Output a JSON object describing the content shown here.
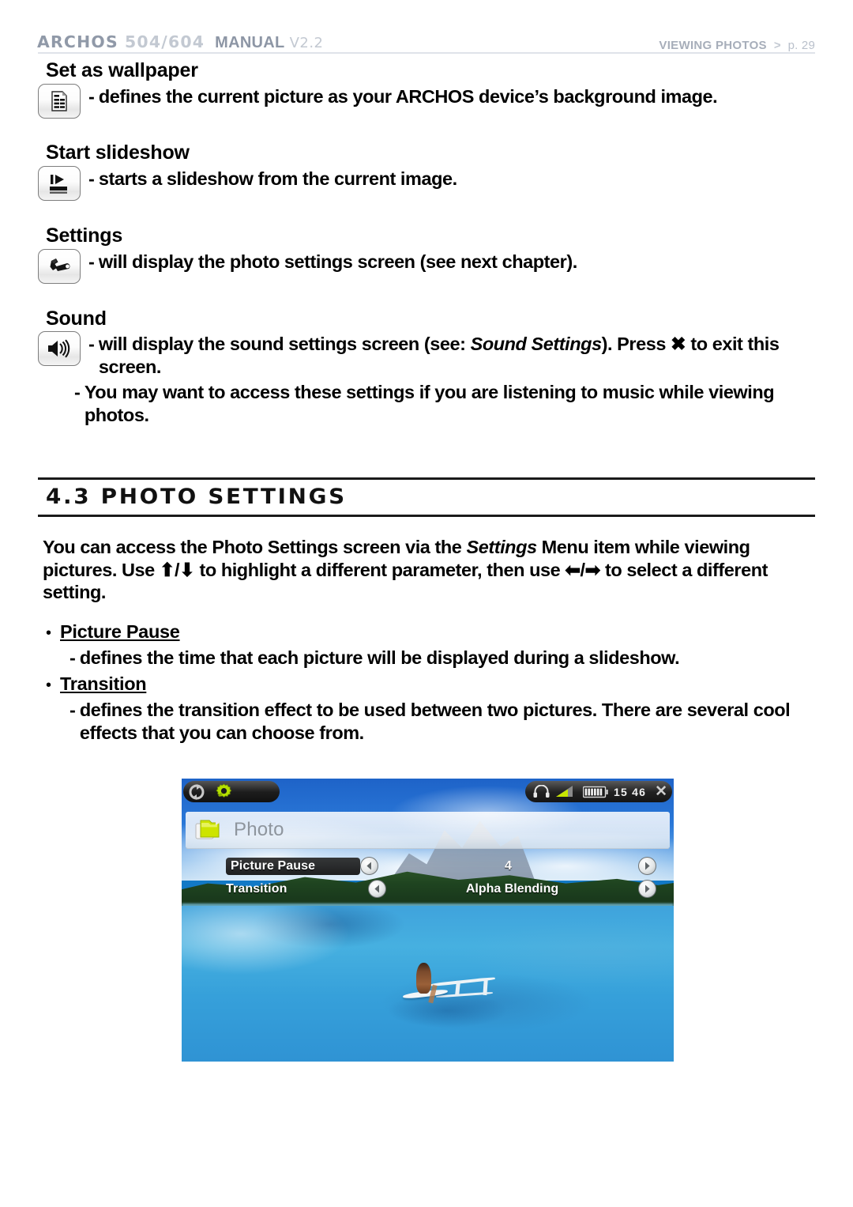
{
  "header": {
    "brand": "ARCHOS",
    "model": "504/604",
    "manual": "MANUAL",
    "version": "V2.2",
    "section": "VIEWING PHOTOS",
    "separator": ">",
    "page": "p. 29"
  },
  "entries": [
    {
      "title": "Set as wallpaper",
      "icon": "document-lines-icon",
      "desc_dash": "-",
      "desc": "defines the current picture as your ARCHOS device’s background image."
    },
    {
      "title": "Start slideshow",
      "icon": "slideshow-play-icon",
      "desc_dash": "-",
      "desc": "starts a slideshow from the current image."
    },
    {
      "title": "Settings",
      "icon": "wrench-icon",
      "desc_dash": "-",
      "desc": "will display the photo settings screen (see next chapter)."
    },
    {
      "title": "Sound",
      "icon": "speaker-icon",
      "desc_dash": "-",
      "desc_part1": "will display the sound settings screen (see: ",
      "desc_italic": "Sound Settings",
      "desc_part2": "). Press ✖ to exit this screen.",
      "sub_dash": "-",
      "sub": "You may want to access these settings if you are listening to music while viewing photos."
    }
  ],
  "section": {
    "number": "4.3",
    "title": "PHOTO SETTINGS",
    "intro_part1": "You can access the Photo Settings screen via the ",
    "intro_italic": "Settings",
    "intro_part2": " Menu item while viewing pictures. Use ⬆/⬇ to highlight a different parameter, then use ⬅/➡ to select a different setting."
  },
  "bullets": [
    {
      "marker": "•",
      "head": "Picture Pause",
      "dash": "-",
      "desc": "defines the time that each picture will be displayed during a slideshow."
    },
    {
      "marker": "•",
      "head": "Transition",
      "dash": "-",
      "desc": "defines the transition effect to be used between two pictures. There are several cool effects that you can choose from."
    }
  ],
  "device": {
    "toolbar": {
      "rotate_icon": "rotate-refresh-icon",
      "settings_icon": "gear-wrench-icon",
      "headphone_icon": "headphone-icon",
      "volume_icon": "volume-wedge-icon",
      "battery_icon": "battery-icon",
      "clock": "15 46",
      "close_icon": "close-x-icon"
    },
    "panel_title": "Photo",
    "panel_icon": "photo-folder-icon",
    "rows": [
      {
        "name": "Picture Pause",
        "value": "4",
        "selected": true,
        "left_icon": "arrow-left-icon",
        "right_icon": "arrow-right-icon"
      },
      {
        "name": "Transition",
        "value": "Alpha Blending",
        "selected": false,
        "left_icon": "arrow-left-icon",
        "right_icon": "arrow-right-icon"
      }
    ]
  },
  "colors": {
    "header_dark": "#9099a8",
    "header_light": "#c3c9d2",
    "rule": "#dfe3e9",
    "accent_green": "#b5e000"
  }
}
